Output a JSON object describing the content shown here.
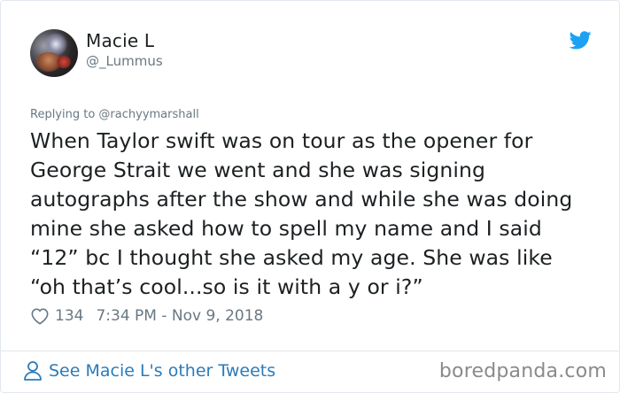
{
  "author": {
    "name": "Macie L",
    "handle": "@_Lummus"
  },
  "tweet": {
    "replying_to": "Replying to @rachyymarshall",
    "text_lines": [
      "When Taylor swift was on tour as the opener for",
      "George Strait we went and she was signing",
      "autographs after the show and while she was doing",
      "mine she asked how to spell my name and I said",
      "“12” bc I thought she asked my age. She was like",
      "“oh that’s cool...so is it with a y or i?”"
    ],
    "likes": "134",
    "timestamp": "7:34 PM - Nov 9, 2018"
  },
  "footer": {
    "see_more": "See Macie L's other Tweets",
    "watermark": "boredpanda.com"
  },
  "colors": {
    "twitter_blue": "#1da1f2",
    "link_blue": "#2b7bb9",
    "muted_gray": "#697882"
  },
  "icons": {
    "brand": "twitter-bird-icon",
    "like": "heart-icon",
    "profile": "person-icon"
  }
}
